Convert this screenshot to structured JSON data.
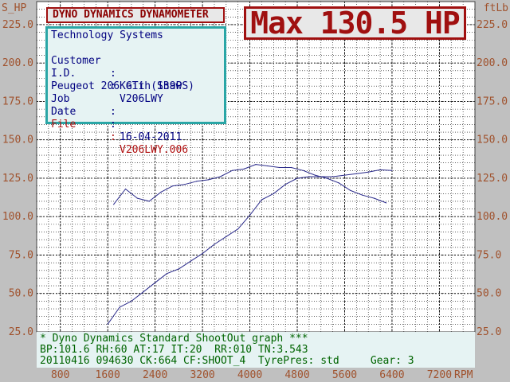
{
  "header": {
    "title": "DYNO DYNAMICS DYNAMOMETER"
  },
  "max_label": "Max 130.5 HP",
  "info": {
    "company": "Technology Systems",
    "rows": [
      {
        "key": "Customer",
        "value": "Keith Shaw"
      },
      {
        "key": "I.D.",
        "value": "V206LWY"
      },
      {
        "key": "Peugeot 206 GTi (139PS)",
        "value": ""
      },
      {
        "key": "Job",
        "value": ""
      },
      {
        "key": "Date",
        "value": "16-04-2011"
      },
      {
        "key": "File",
        "value": "V206LWY.006"
      }
    ]
  },
  "footer": {
    "line1": "* Dyno Dynamics Standard ShootOut graph ***",
    "line2": "BP:101.6 RH:60 AT:17 IT:20  RR:010 TN:3.543",
    "line3": "20110416 094630 CK:664 CF:SHOOT_4  TyrePres: std     Gear: 3"
  },
  "colors": {
    "background": "#c0c0c0",
    "plot_area": "#ffffff",
    "grid": "#000000",
    "power_curve": "#2a2a8a",
    "torque_curve": "#2a2a8a",
    "axis_text": "#a0522d",
    "title_red": "#a01010",
    "info_border": "#2aa6a6"
  },
  "chart_data": {
    "type": "line",
    "xlabel": "RPM",
    "left_axis_label": "S_HP",
    "right_axis_label": "ftLb",
    "x_ticks": [
      800,
      1600,
      2400,
      3200,
      4000,
      4800,
      5600,
      6400,
      7200
    ],
    "y_ticks": [
      25.0,
      50.0,
      75.0,
      100.0,
      125.0,
      150.0,
      175.0,
      200.0,
      225.0
    ],
    "y_tick_labels": [
      "25.0",
      "50.0",
      "75.0",
      "100.0",
      "125.0",
      "150.0",
      "175.0",
      "200.0",
      "225.0"
    ],
    "xlim": [
      400,
      7800
    ],
    "ylim": [
      25,
      240
    ],
    "grid": true,
    "series": [
      {
        "x": [
          1600,
          1800,
          2000,
          2200,
          2400,
          2600,
          2800,
          3000,
          3200,
          3400,
          3600,
          3800,
          4000,
          4200,
          4400,
          4600,
          4800,
          5000,
          5200,
          5400,
          5600,
          5800,
          6000,
          6200,
          6400
        ],
        "values": [
          30,
          41,
          45,
          51,
          57,
          63,
          66,
          71,
          76,
          82,
          87,
          92,
          101,
          111,
          115,
          121,
          125,
          126,
          126,
          126,
          127,
          128,
          129,
          130.5,
          130
        ]
      },
      {
        "x": [
          1700,
          1900,
          2100,
          2300,
          2500,
          2700,
          2900,
          3100,
          3300,
          3500,
          3700,
          3900,
          4100,
          4300,
          4500,
          4700,
          4900,
          5100,
          5300,
          5500,
          5700,
          5900,
          6100,
          6300
        ],
        "values": [
          108,
          118,
          112,
          110,
          116,
          120,
          121,
          123,
          124,
          126,
          130,
          131,
          134,
          133,
          132,
          132,
          130,
          127,
          125,
          122,
          117,
          114,
          112,
          109
        ]
      }
    ]
  }
}
